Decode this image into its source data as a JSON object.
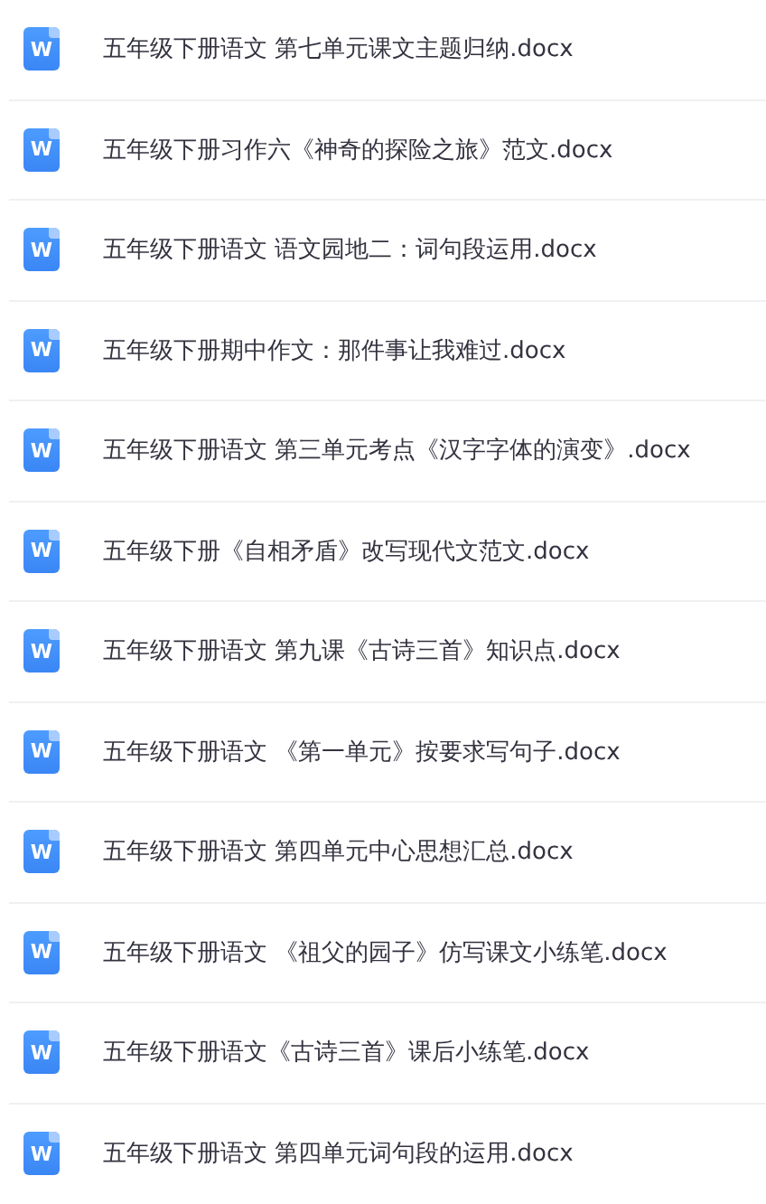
{
  "files": [
    {
      "icon_label": "W",
      "name": "五年级下册语文 第七单元课文主题归纳.docx"
    },
    {
      "icon_label": "W",
      "name": "五年级下册习作六《神奇的探险之旅》范文.docx"
    },
    {
      "icon_label": "W",
      "name": "五年级下册语文 语文园地二：词句段运用.docx"
    },
    {
      "icon_label": "W",
      "name": "五年级下册期中作文：那件事让我难过.docx"
    },
    {
      "icon_label": "W",
      "name": "五年级下册语文 第三单元考点《汉字字体的演变》.docx"
    },
    {
      "icon_label": "W",
      "name": "五年级下册《自相矛盾》改写现代文范文.docx"
    },
    {
      "icon_label": "W",
      "name": "五年级下册语文 第九课《古诗三首》知识点.docx"
    },
    {
      "icon_label": "W",
      "name": "五年级下册语文 《第一单元》按要求写句子.docx"
    },
    {
      "icon_label": "W",
      "name": "五年级下册语文 第四单元中心思想汇总.docx"
    },
    {
      "icon_label": "W",
      "name": "五年级下册语文 《祖父的园子》仿写课文小练笔.docx"
    },
    {
      "icon_label": "W",
      "name": "五年级下册语文《古诗三首》课后小练笔.docx"
    },
    {
      "icon_label": "W",
      "name": "五年级下册语文 第四单元词句段的运用.docx"
    }
  ]
}
